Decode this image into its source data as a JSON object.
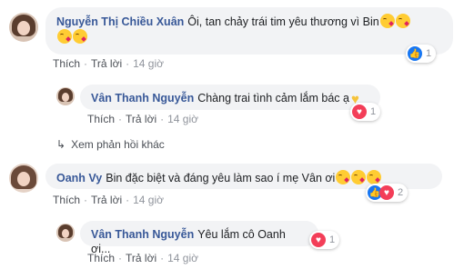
{
  "comments": [
    {
      "author": "Nguyễn Thị Chiều Xuân",
      "text": "Ôi, tan chảy trái tim yêu thương vì Bin",
      "like": "Thích",
      "reply": "Trả lời",
      "time": "14 giờ",
      "reaction_count": "1",
      "reaction": "like-icon"
    },
    {
      "author": "Vân Thanh Nguyễn",
      "text": "Chàng trai tình cảm lắm bác ạ",
      "like": "Thích",
      "reply": "Trả lời",
      "time": "14 giờ",
      "reaction_count": "1",
      "reaction": "love-icon"
    },
    {
      "author": "Oanh Vy",
      "text": "Bin đặc biệt và đáng yêu làm sao í mẹ Vân ơi",
      "like": "Thích",
      "reply": "Trả lời",
      "time": "14 giờ",
      "reaction_count": "2",
      "reaction": "like-love-icons"
    },
    {
      "author": "Vân Thanh Nguyễn",
      "text": "Yêu lắm cô Oanh ơi...",
      "like": "Thích",
      "reply": "Trả lời",
      "time": "14 giờ",
      "reaction_count": "1",
      "reaction": "love-icon"
    }
  ],
  "more_replies": "Xem phản hồi khác",
  "colors": {
    "author": "#385898",
    "bubble": "#f2f3f5",
    "like_blue": "#1877f2",
    "love_red": "#f33e58"
  }
}
